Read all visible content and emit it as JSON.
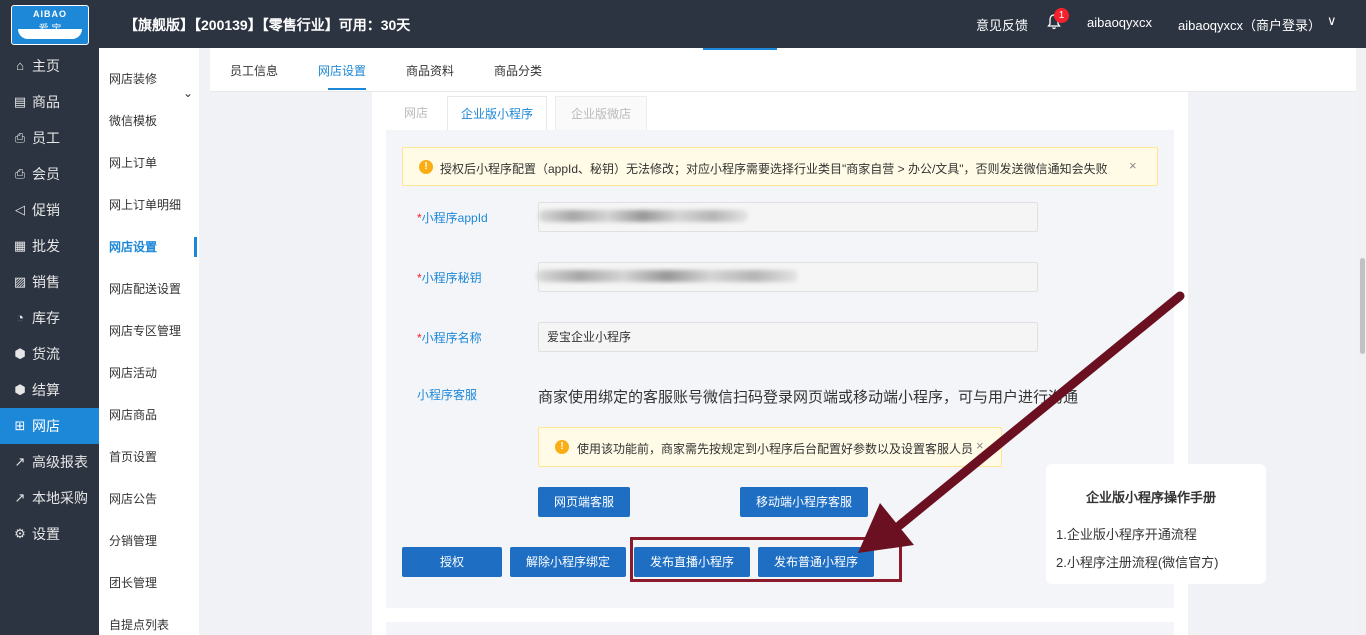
{
  "header": {
    "logo_text": "AIBAO",
    "logo_sub": "爱 宝",
    "title": "【旗舰版】【200139】【零售行业】可用：30天",
    "feedback": "意见反馈",
    "notification_count": "1",
    "user": "aibaoqyxcx",
    "account": "aibaoqyxcx（商户登录）",
    "account_chevron": "∨"
  },
  "sidebar": {
    "items": [
      {
        "label": "主页",
        "icon": "⌂"
      },
      {
        "label": "商品",
        "icon": "▤"
      },
      {
        "label": "员工",
        "icon": "⎙"
      },
      {
        "label": "会员",
        "icon": "⎙"
      },
      {
        "label": "促销",
        "icon": "◁"
      },
      {
        "label": "批发",
        "icon": "▦"
      },
      {
        "label": "销售",
        "icon": "▨"
      },
      {
        "label": "库存",
        "icon": "◔"
      },
      {
        "label": "货流",
        "icon": "⬢"
      },
      {
        "label": "结算",
        "icon": "⬢"
      },
      {
        "label": "网店",
        "icon": "⊞"
      },
      {
        "label": "高级报表",
        "icon": "↗"
      },
      {
        "label": "本地采购",
        "icon": "↗"
      },
      {
        "label": "设置",
        "icon": "⚙"
      }
    ],
    "active_index": 10
  },
  "subnav": {
    "items": [
      "网店装修",
      "微信模板",
      "网上订单",
      "网上订单明细",
      "网店设置",
      "网店配送设置",
      "网店专区管理",
      "网店活动",
      "网店商品",
      "首页设置",
      "网店公告",
      "分销管理",
      "团长管理",
      "自提点列表"
    ],
    "active_index": 4
  },
  "tabs": [
    "员工信息",
    "网店设置",
    "商品资料",
    "商品分类"
  ],
  "subtabs": [
    "网店",
    "企业版小程序",
    "企业版微店"
  ],
  "warning_main": "授权后小程序配置（appId、秘钥）无法修改；对应小程序需要选择行业类目\"商家自营 > 办公/文具\"，否则发送微信通知会失败",
  "warning_close": "×",
  "form": {
    "appid_label": "小程序appId",
    "secret_label": "小程序秘钥",
    "name_label": "小程序名称",
    "name_value": "爱宝企业小程序",
    "service_label": "小程序客服",
    "required_mark": "*",
    "service_desc": "商家使用绑定的客服账号微信扫码登录网页端或移动端小程序，可与用户进行沟通",
    "service_warning": "使用该功能前，商家需先按规定到小程序后台配置好参数以及设置客服人员",
    "service_warning_close": "×",
    "web_service_btn": "网页端客服",
    "mobile_service_btn": "移动端小程序客服"
  },
  "actions": {
    "authorize": "授权",
    "unbind": "解除小程序绑定",
    "publish_live": "发布直播小程序",
    "publish_normal": "发布普通小程序"
  },
  "manual": {
    "title": "企业版小程序操作手册",
    "links": [
      "1.企业版小程序开通流程",
      "2.小程序注册流程(微信官方)"
    ]
  },
  "colors": {
    "brand": "#1e88d8",
    "sidebar_bg": "#2c3441",
    "annotation": "#8b1a2b"
  }
}
